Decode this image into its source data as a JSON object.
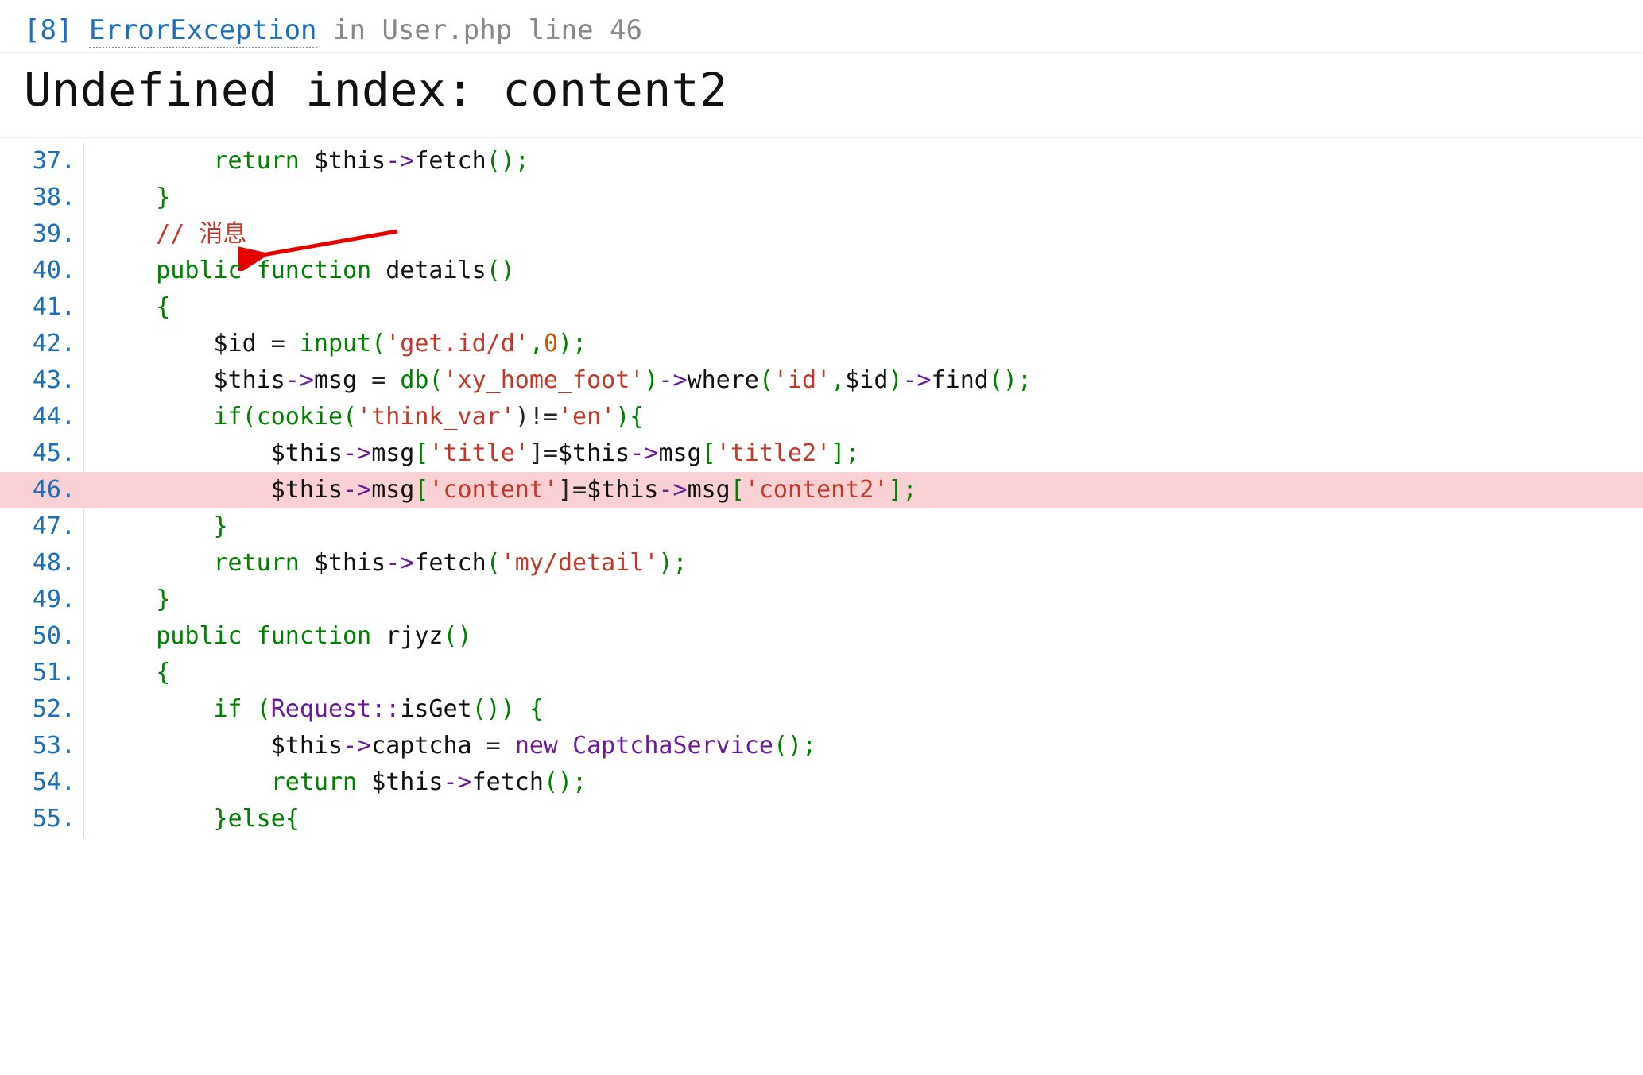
{
  "header": {
    "bracket_open": "[",
    "errno": "8",
    "bracket_close": "]",
    "exception": "ErrorException",
    "in_word": "in",
    "file": "User.php line 46"
  },
  "title": "Undefined index: content2",
  "error_line": 46,
  "code": [
    {
      "n": 37,
      "indent": "        ",
      "tokens": [
        {
          "t": "return ",
          "c": "kw"
        },
        {
          "t": "$this",
          "c": "var"
        },
        {
          "t": "->",
          "c": "op"
        },
        {
          "t": "fetch",
          "c": "method"
        },
        {
          "t": "();",
          "c": "punct"
        }
      ]
    },
    {
      "n": 38,
      "indent": "    ",
      "tokens": [
        {
          "t": "}",
          "c": "punct"
        }
      ]
    },
    {
      "n": 39,
      "indent": "    ",
      "tokens": [
        {
          "t": "// 消息",
          "c": "cmt"
        }
      ]
    },
    {
      "n": 40,
      "indent": "    ",
      "tokens": [
        {
          "t": "public ",
          "c": "kw"
        },
        {
          "t": "function ",
          "c": "kw"
        },
        {
          "t": "details",
          "c": "fn"
        },
        {
          "t": "()",
          "c": "punct"
        }
      ]
    },
    {
      "n": 41,
      "indent": "    ",
      "tokens": [
        {
          "t": "{",
          "c": "punct"
        }
      ]
    },
    {
      "n": 42,
      "indent": "        ",
      "tokens": [
        {
          "t": "$id",
          "c": "var"
        },
        {
          "t": " = ",
          "c": "name"
        },
        {
          "t": "input",
          "c": "builtin"
        },
        {
          "t": "(",
          "c": "punct"
        },
        {
          "t": "'get.id/d'",
          "c": "str"
        },
        {
          "t": ",",
          "c": "punct"
        },
        {
          "t": "0",
          "c": "num"
        },
        {
          "t": ");",
          "c": "punct"
        }
      ]
    },
    {
      "n": 43,
      "indent": "        ",
      "tokens": [
        {
          "t": "$this",
          "c": "var"
        },
        {
          "t": "->",
          "c": "op"
        },
        {
          "t": "msg",
          "c": "method"
        },
        {
          "t": " = ",
          "c": "name"
        },
        {
          "t": "db",
          "c": "builtin"
        },
        {
          "t": "(",
          "c": "punct"
        },
        {
          "t": "'xy_home_foot'",
          "c": "str"
        },
        {
          "t": ")",
          "c": "punct"
        },
        {
          "t": "->",
          "c": "op"
        },
        {
          "t": "where",
          "c": "method"
        },
        {
          "t": "(",
          "c": "punct"
        },
        {
          "t": "'id'",
          "c": "str"
        },
        {
          "t": ",",
          "c": "punct"
        },
        {
          "t": "$id",
          "c": "var"
        },
        {
          "t": ")",
          "c": "punct"
        },
        {
          "t": "->",
          "c": "op"
        },
        {
          "t": "find",
          "c": "method"
        },
        {
          "t": "();",
          "c": "punct"
        }
      ]
    },
    {
      "n": 44,
      "indent": "        ",
      "tokens": [
        {
          "t": "if",
          "c": "kw"
        },
        {
          "t": "(",
          "c": "punct"
        },
        {
          "t": "cookie",
          "c": "builtin"
        },
        {
          "t": "(",
          "c": "punct"
        },
        {
          "t": "'think_var'",
          "c": "str"
        },
        {
          "t": ")!=",
          "c": "name"
        },
        {
          "t": "'en'",
          "c": "str"
        },
        {
          "t": "){",
          "c": "punct"
        }
      ]
    },
    {
      "n": 45,
      "indent": "            ",
      "tokens": [
        {
          "t": "$this",
          "c": "var"
        },
        {
          "t": "->",
          "c": "op"
        },
        {
          "t": "msg",
          "c": "method"
        },
        {
          "t": "[",
          "c": "punct"
        },
        {
          "t": "'title'",
          "c": "str"
        },
        {
          "t": "]=",
          "c": "name"
        },
        {
          "t": "$this",
          "c": "var"
        },
        {
          "t": "->",
          "c": "op"
        },
        {
          "t": "msg",
          "c": "method"
        },
        {
          "t": "[",
          "c": "punct"
        },
        {
          "t": "'title2'",
          "c": "str"
        },
        {
          "t": "];",
          "c": "punct"
        }
      ]
    },
    {
      "n": 46,
      "indent": "            ",
      "tokens": [
        {
          "t": "$this",
          "c": "var"
        },
        {
          "t": "->",
          "c": "op"
        },
        {
          "t": "msg",
          "c": "method"
        },
        {
          "t": "[",
          "c": "punct"
        },
        {
          "t": "'content'",
          "c": "str"
        },
        {
          "t": "]=",
          "c": "name"
        },
        {
          "t": "$this",
          "c": "var"
        },
        {
          "t": "->",
          "c": "op"
        },
        {
          "t": "msg",
          "c": "method"
        },
        {
          "t": "[",
          "c": "punct"
        },
        {
          "t": "'content2'",
          "c": "str"
        },
        {
          "t": "];",
          "c": "punct"
        }
      ]
    },
    {
      "n": 47,
      "indent": "        ",
      "tokens": [
        {
          "t": "}",
          "c": "punct"
        }
      ]
    },
    {
      "n": 48,
      "indent": "        ",
      "tokens": [
        {
          "t": "return ",
          "c": "kw"
        },
        {
          "t": "$this",
          "c": "var"
        },
        {
          "t": "->",
          "c": "op"
        },
        {
          "t": "fetch",
          "c": "method"
        },
        {
          "t": "(",
          "c": "punct"
        },
        {
          "t": "'my/detail'",
          "c": "str"
        },
        {
          "t": ");",
          "c": "punct"
        }
      ]
    },
    {
      "n": 49,
      "indent": "    ",
      "tokens": [
        {
          "t": "}",
          "c": "punct"
        }
      ]
    },
    {
      "n": 50,
      "indent": "    ",
      "tokens": [
        {
          "t": "public ",
          "c": "kw"
        },
        {
          "t": "function ",
          "c": "kw"
        },
        {
          "t": "rjyz",
          "c": "fn"
        },
        {
          "t": "()",
          "c": "punct"
        }
      ]
    },
    {
      "n": 51,
      "indent": "    ",
      "tokens": [
        {
          "t": "{",
          "c": "punct"
        }
      ]
    },
    {
      "n": 52,
      "indent": "        ",
      "tokens": [
        {
          "t": "if ",
          "c": "kw"
        },
        {
          "t": "(",
          "c": "punct"
        },
        {
          "t": "Request",
          "c": "class"
        },
        {
          "t": "::",
          "c": "op"
        },
        {
          "t": "isGet",
          "c": "method"
        },
        {
          "t": "()) {",
          "c": "punct"
        }
      ]
    },
    {
      "n": 53,
      "indent": "            ",
      "tokens": [
        {
          "t": "$this",
          "c": "var"
        },
        {
          "t": "->",
          "c": "op"
        },
        {
          "t": "captcha",
          "c": "method"
        },
        {
          "t": " = ",
          "c": "name"
        },
        {
          "t": "new ",
          "c": "new"
        },
        {
          "t": "CaptchaService",
          "c": "class"
        },
        {
          "t": "();",
          "c": "punct"
        }
      ]
    },
    {
      "n": 54,
      "indent": "            ",
      "tokens": [
        {
          "t": "return ",
          "c": "kw"
        },
        {
          "t": "$this",
          "c": "var"
        },
        {
          "t": "->",
          "c": "op"
        },
        {
          "t": "fetch",
          "c": "method"
        },
        {
          "t": "();",
          "c": "punct"
        }
      ]
    },
    {
      "n": 55,
      "indent": "        ",
      "tokens": [
        {
          "t": "}",
          "c": "punct"
        },
        {
          "t": "else",
          "c": "kw"
        },
        {
          "t": "{",
          "c": "punct"
        }
      ]
    }
  ]
}
